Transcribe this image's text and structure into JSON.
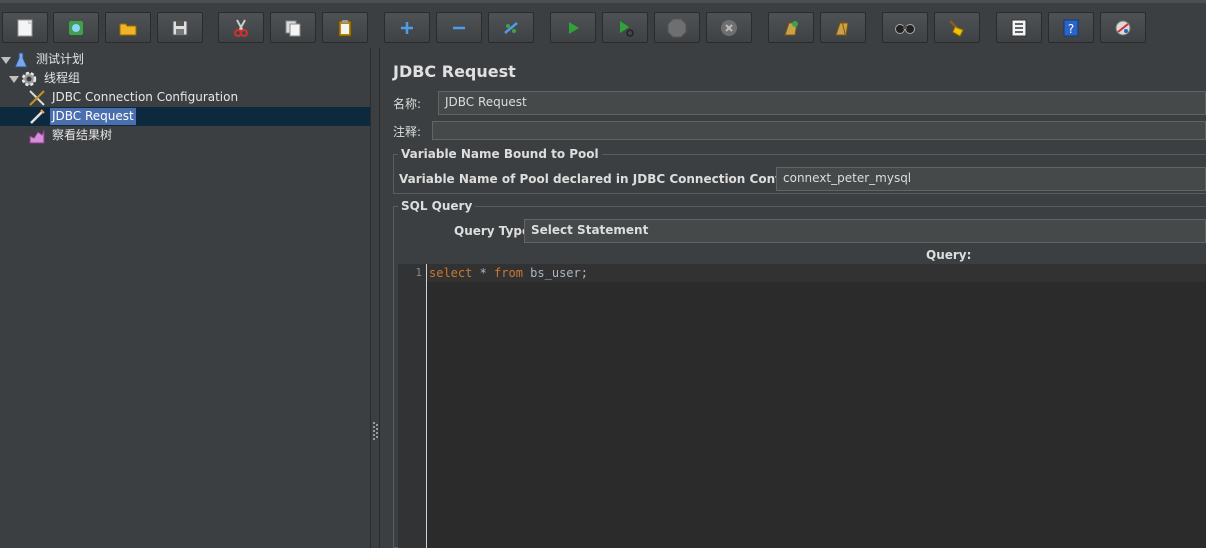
{
  "toolbar": {
    "buttons": [
      {
        "icon": "new-icon"
      },
      {
        "icon": "templates-icon"
      },
      {
        "icon": "open-icon"
      },
      {
        "icon": "save-icon"
      },
      {
        "icon": "cut-icon"
      },
      {
        "icon": "copy-icon"
      },
      {
        "icon": "paste-icon"
      },
      {
        "icon": "expand-icon"
      },
      {
        "icon": "collapse-icon"
      },
      {
        "icon": "toggle-icon"
      },
      {
        "icon": "start-icon"
      },
      {
        "icon": "start-no-pauses-icon"
      },
      {
        "icon": "stop-icon"
      },
      {
        "icon": "shutdown-icon"
      },
      {
        "icon": "clear-icon"
      },
      {
        "icon": "clear-all-icon"
      },
      {
        "icon": "search-icon"
      },
      {
        "icon": "reset-search-icon"
      },
      {
        "icon": "function-helper-icon"
      },
      {
        "icon": "help-icon"
      },
      {
        "icon": "remote-icon"
      }
    ]
  },
  "tree": {
    "items": [
      {
        "label": "测试计划",
        "icon": "test-plan-icon"
      },
      {
        "label": "线程组",
        "icon": "thread-group-icon"
      },
      {
        "label": "JDBC Connection Configuration",
        "icon": "config-element-icon"
      },
      {
        "label": "JDBC Request",
        "icon": "sampler-icon"
      },
      {
        "label": "察看结果树",
        "icon": "listener-icon"
      }
    ]
  },
  "editor": {
    "title": "JDBC Request",
    "name_label": "名称:",
    "name_value": "JDBC Request",
    "comment_label": "注释:",
    "comment_value": "",
    "pool_group_title": "Variable Name Bound to Pool",
    "pool_label": "Variable Name of Pool declared in JDBC Connection Configuration:",
    "pool_value": "connext_peter_mysql",
    "sql_group_title": "SQL Query",
    "query_type_label": "Query Type:",
    "query_type_value": "Select Statement",
    "query_label": "Query:",
    "code": {
      "line_number": "1",
      "kw_select": "select",
      "mid": " * ",
      "kw_from": "from",
      "rest": " bs_user;"
    }
  },
  "colors": {
    "background": "#3c3f41",
    "selection": "#4b6eaf",
    "keyword": "#cc7832",
    "editor_bg": "#2b2b2b"
  }
}
